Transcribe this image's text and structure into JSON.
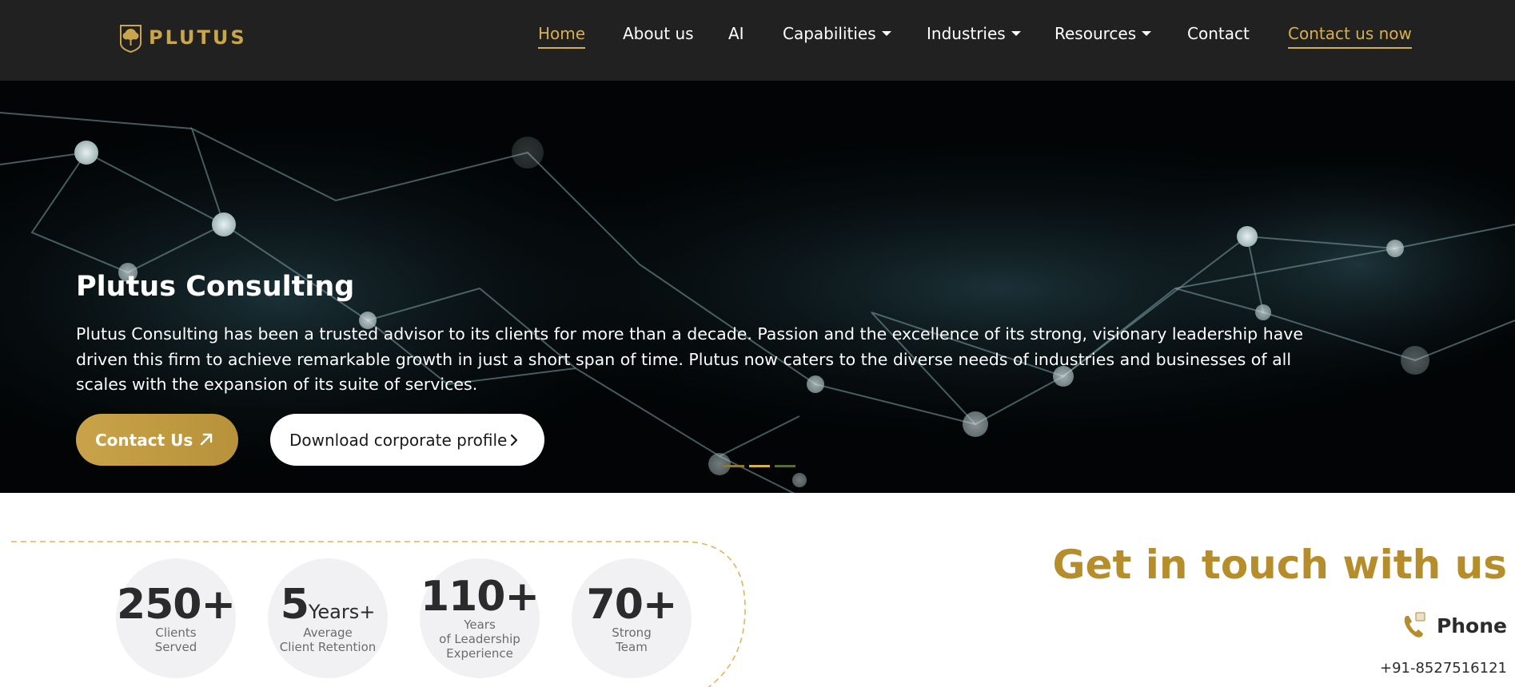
{
  "brand": {
    "name": "PLUTUS",
    "accent": "#d6b04f",
    "navbar_bg": "#212121"
  },
  "nav": {
    "items": [
      {
        "label": "Home",
        "active": true
      },
      {
        "label": "About us"
      },
      {
        "label": "AI"
      },
      {
        "label": "Capabilities",
        "dropdown": true
      },
      {
        "label": "Industries",
        "dropdown": true
      },
      {
        "label": "Resources",
        "dropdown": true
      },
      {
        "label": "Contact"
      }
    ],
    "cta": "Contact us now"
  },
  "hero": {
    "title": "Plutus Consulting",
    "description": "Plutus Consulting has been a trusted advisor to its clients for more than a decade. Passion and the excellence of its strong, visionary leadership have driven this firm to achieve remarkable growth in just a short span of time. Plutus now caters to the diverse needs of industries and businesses of all scales with the expansion of its suite of services.",
    "primary_button": "Contact Us",
    "secondary_button": "Download corporate profile",
    "carousel": {
      "slides": 3,
      "active": 2
    }
  },
  "stats": [
    {
      "value": "250+",
      "suffix": "",
      "label_lines": [
        "Clients",
        "Served"
      ]
    },
    {
      "value": "5",
      "suffix": "Years+",
      "label_lines": [
        "Average",
        "Client Retention"
      ]
    },
    {
      "value": "110+",
      "suffix": "",
      "label_lines": [
        "Years",
        "of Leadership",
        "Experience"
      ]
    },
    {
      "value": "70+",
      "suffix": "",
      "label_lines": [
        "Strong",
        "Team"
      ]
    }
  ],
  "contact": {
    "title": "Get in touch with us",
    "phone_label": "Phone",
    "phone_number": "+91-8527516121",
    "phone_icon": "phone-icon"
  }
}
